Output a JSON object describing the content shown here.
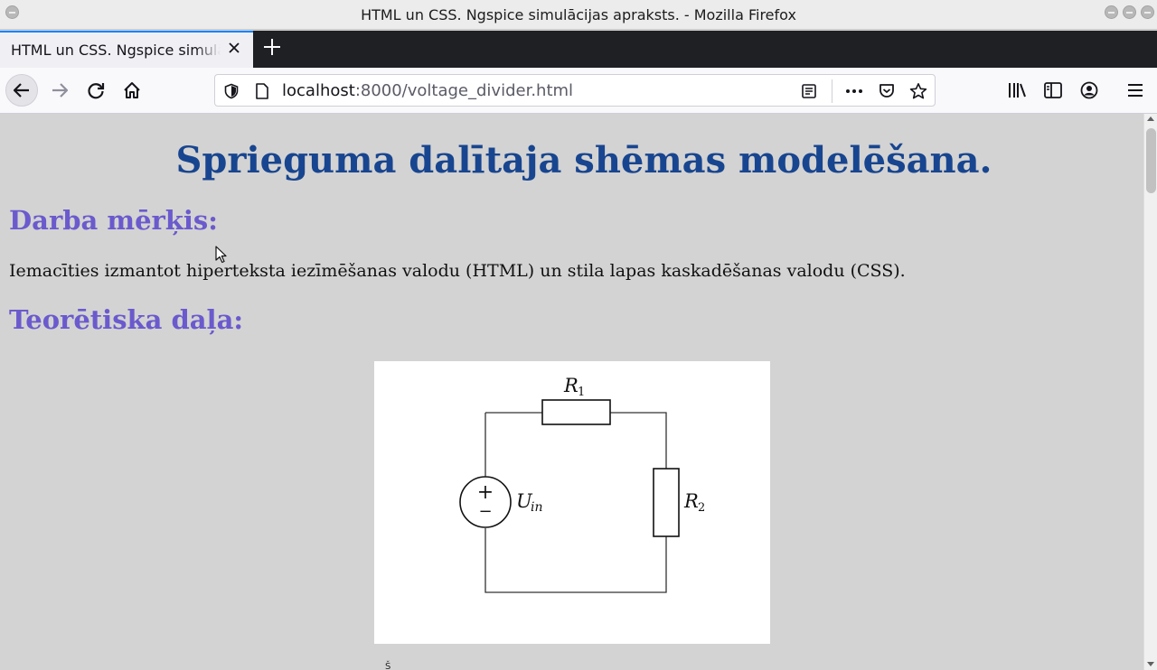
{
  "window": {
    "title": "HTML un CSS. Ngspice simulācijas apraksts. - Mozilla Firefox"
  },
  "tabs": [
    {
      "label": "HTML un CSS. Ngspice simulācijas apraksts.",
      "active": true
    }
  ],
  "navbar": {
    "url_host": "localhost",
    "url_rest": ":8000/voltage_divider.html"
  },
  "page": {
    "heading": "Sprieguma dalītaja shēmas modelēšana.",
    "section_goal_title": "Darba mērķis:",
    "goal_text": "Iemacīties izmantot hiperteksta iezīmēšanas valodu (HTML) un stila lapas kaskadēšanas valodu (CSS).",
    "section_theory_title": "Teorētiska daļa:",
    "partial_below": "Š",
    "figure": {
      "r1_label": "R",
      "r1_sub": "1",
      "r2_label": "R",
      "r2_sub": "2",
      "uin_label": "U",
      "uin_sub": "in",
      "source_plus": "+",
      "source_minus": "−"
    }
  },
  "colors": {
    "heading": "#18458f",
    "section_title": "#6a5acd",
    "page_background": "#d3d3d3",
    "tab_accent": "#0a84ff"
  },
  "icons": [
    "back-arrow-icon",
    "forward-arrow-icon",
    "reload-icon",
    "home-icon",
    "tracking-shield-icon",
    "page-icon",
    "reader-view-icon",
    "more-actions-icon",
    "pocket-icon",
    "bookmark-star-icon",
    "library-icon",
    "sidebar-icon",
    "account-icon",
    "hamburger-menu-icon"
  ]
}
